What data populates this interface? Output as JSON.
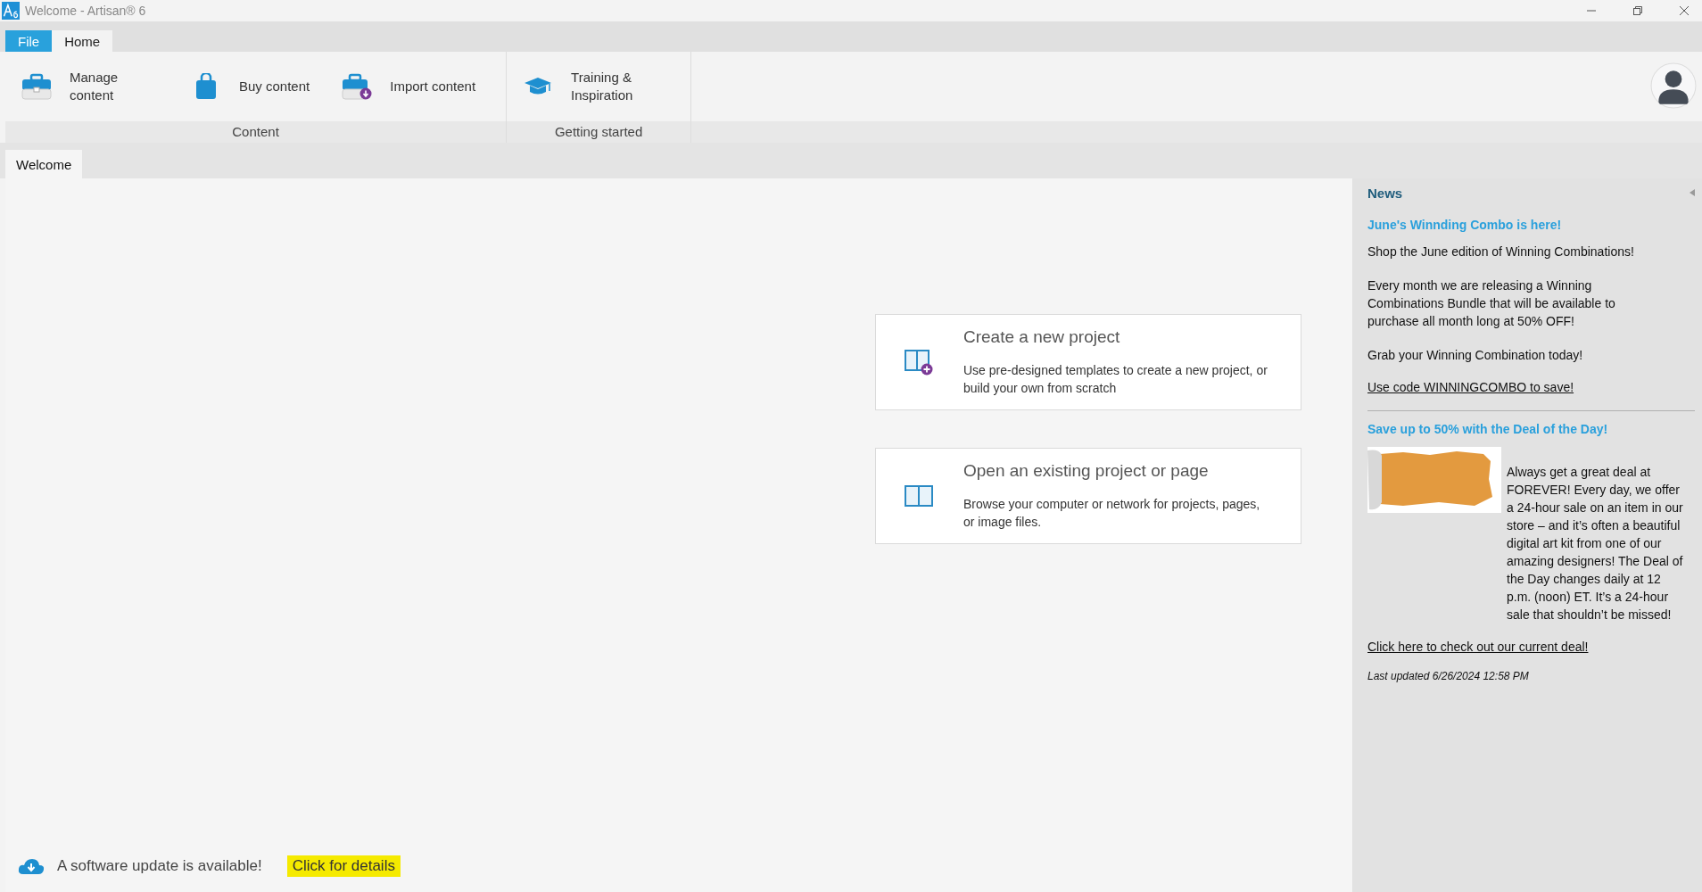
{
  "window": {
    "title": "Welcome - Artisan® 6"
  },
  "ribbon_tabs": [
    {
      "label": "File",
      "kind": "file",
      "selected": false
    },
    {
      "label": "Home",
      "kind": "tab",
      "selected": true
    }
  ],
  "ribbon_groups": [
    {
      "label": "Content",
      "buttons": [
        {
          "label": "Manage content",
          "kind": "toolbox"
        },
        {
          "label": "Buy content",
          "kind": "bag"
        },
        {
          "label": "Import content",
          "kind": "import"
        }
      ]
    },
    {
      "label": "Getting started",
      "buttons": [
        {
          "label": "Training & Inspiration",
          "kind": "cap"
        }
      ]
    }
  ],
  "document_tabs": [
    {
      "label": "Welcome",
      "selected": true
    }
  ],
  "actions": [
    {
      "title": "Create a new project",
      "description": "Use pre-designed templates to create a new project, or build your own from scratch",
      "kind": "new"
    },
    {
      "title": "Open an existing project or page",
      "description": "Browse your computer or network for projects, pages, or image files.",
      "kind": "open"
    }
  ],
  "update_bar": {
    "message": "A software update is available!",
    "link": "Click for details",
    "highlighted": true
  },
  "news": {
    "title": "News",
    "items": [
      {
        "kind": "headline",
        "text": "June's Winnding Combo is here!"
      },
      {
        "kind": "paragraph",
        "text": "Shop the June edition of Winning Combinations!"
      },
      {
        "kind": "paragraph",
        "text": "Every month we are releasing a Winning Combinations Bundle that will be available to purchase all month long at 50% OFF!"
      },
      {
        "kind": "paragraph",
        "text": "Grab your Winning Combination today!"
      },
      {
        "kind": "link",
        "text": "Use code WINNINGCOMBO to save!"
      },
      {
        "kind": "divider"
      },
      {
        "kind": "headline",
        "text": "Save up to 50% with the Deal of the Day!"
      },
      {
        "kind": "image_text",
        "text": "Always get a great deal at FOREVER! Every day, we offer a 24-hour sale on an item in our store – and it’s often a beautiful digital art kit from one of our amazing designers! The Deal of the Day changes daily at 12 p.m. (noon) ET.  It’s a 24-hour sale that shouldn’t be missed!"
      },
      {
        "kind": "link",
        "text": "Click here to check out our current deal!"
      },
      {
        "kind": "timestamp",
        "text": "Last updated 6/26/2024 12:58 PM"
      }
    ]
  }
}
